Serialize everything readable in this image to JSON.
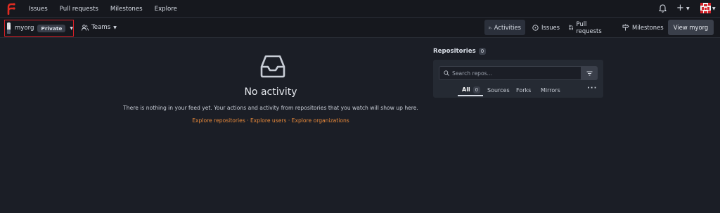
{
  "topnav": {
    "items": [
      "Issues",
      "Pull requests",
      "Milestones",
      "Explore"
    ],
    "plus_label": "+"
  },
  "org": {
    "name": "myorg",
    "visibility": "Private"
  },
  "teams": {
    "label": "Teams"
  },
  "tabs": [
    "Activities",
    "Issues",
    "Pull requests",
    "Milestones"
  ],
  "view_button": "View myorg",
  "empty": {
    "title": "No activity",
    "description": "There is nothing in your feed yet. Your actions and activity from repositories that you watch will show up here.",
    "links": "Explore repositories · Explore users · Explore organizations"
  },
  "repos": {
    "title": "Repositories",
    "count": "0",
    "search_placeholder": "Search repos...",
    "tabs": [
      "All",
      "Sources",
      "Forks",
      "Mirrors"
    ],
    "all_count": "0",
    "more": "···"
  },
  "colors": {
    "background": "#1b1e26",
    "accent_link": "#e8893a",
    "logo_red": "#e02c22",
    "highlight_border": "#d81f26"
  }
}
